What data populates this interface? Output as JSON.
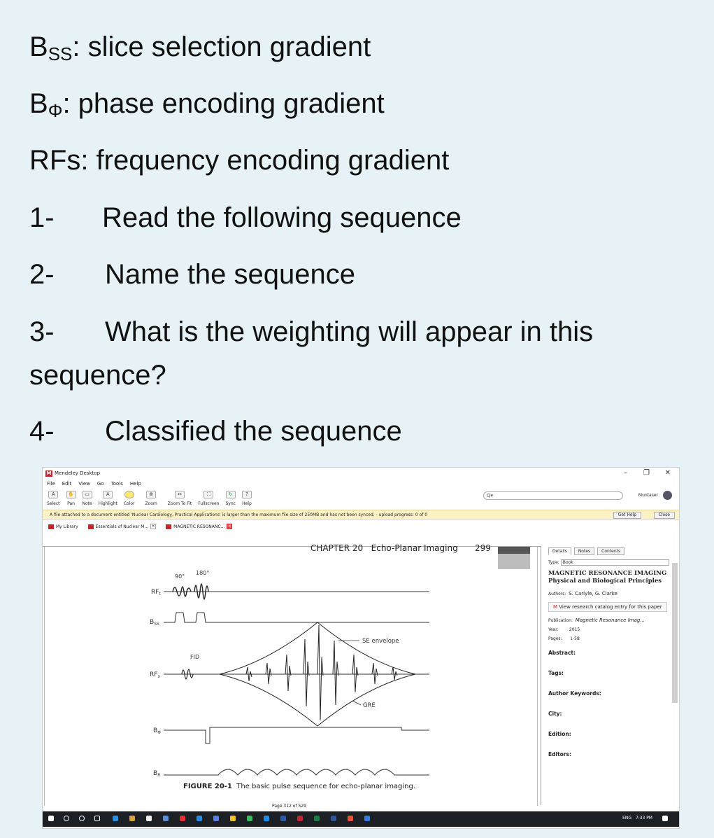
{
  "question": {
    "line1_prefix": "B",
    "line1_sub": "SS",
    "line1_rest": ": slice selection gradient",
    "line2_prefix": "B",
    "line2_sub": "Φ",
    "line2_rest": ": phase encoding gradient",
    "line3": "RFs: frequency encoding gradient",
    "items": [
      {
        "num": "1-",
        "text": "Read the following  sequence"
      },
      {
        "num": "2-",
        "text": "Name the sequence"
      },
      {
        "num": "3-",
        "text": "What is the weighting will appear in this"
      },
      {
        "num": "4-",
        "text": "Classified the sequence"
      }
    ],
    "item3_cont": "sequence?"
  },
  "app": {
    "title": "Mendeley Desktop",
    "menu": [
      "File",
      "Edit",
      "View",
      "Go",
      "Tools",
      "Help"
    ],
    "toolbar": [
      "Select",
      "Pan",
      "Note",
      "Highlight",
      "Color",
      "Zoom",
      "Zoom To Fit",
      "Fullscreen",
      "Sync",
      "Help"
    ],
    "search_placeholder": "Q▾",
    "user": "Muntaser",
    "notice": "A file attached to a document entitled 'Nuclear Cardiology, Practical Applications' is larger than the maximum file size of 250MB and has not been synced. - upload progress: 0 of 0",
    "get_help": "Get Help",
    "close": "Close",
    "tabs": [
      "My Library",
      "Essentials of Nuclear M...",
      "MAGNETIC RESONANC..."
    ],
    "page_indicator": "Page 312 of 529"
  },
  "page": {
    "chapter": "CHAPTER 20",
    "chapter_title": "Echo-Planar Imaging",
    "page_no": "299",
    "figure_label": "FIGURE 20-1",
    "figure_caption": "The basic pulse sequence for echo-planar imaging.",
    "diagram": {
      "rf1_label": "RF",
      "rf1_sub": "t",
      "angle1": "90°",
      "angle2": "180°",
      "bss_label": "B",
      "bss_sub": "SS",
      "rfs_label": "RF",
      "rfs_sub": "s",
      "fid": "FID",
      "se_envelope": "SE envelope",
      "gre": "GRE",
      "bphi_label": "B",
      "bphi_sub": "Φ",
      "br_label": "B",
      "br_sub": "R"
    }
  },
  "details": {
    "tabs": [
      "Details",
      "Notes",
      "Contents"
    ],
    "type_label": "Type:",
    "type_value": "Book",
    "title": "MAGNETIC RESONANCE IMAGING Physical and Biological Principles",
    "authors_label": "Authors:",
    "authors": "S. Carlyle, G. Clarke",
    "catalog_btn": "View research catalog entry for this paper",
    "publication_label": "Publication:",
    "publication": "Magnetic Resonance Imag...",
    "year_label": "Year:",
    "year": "2015",
    "pages_label": "Pages:",
    "pages": "1-58",
    "abstract": "Abstract:",
    "tags": "Tags:",
    "author_keywords": "Author Keywords:",
    "city": "City:",
    "edition": "Edition:",
    "editors": "Editors:"
  },
  "taskbar": {
    "lang": "ENG",
    "time": "7:33 PM"
  }
}
